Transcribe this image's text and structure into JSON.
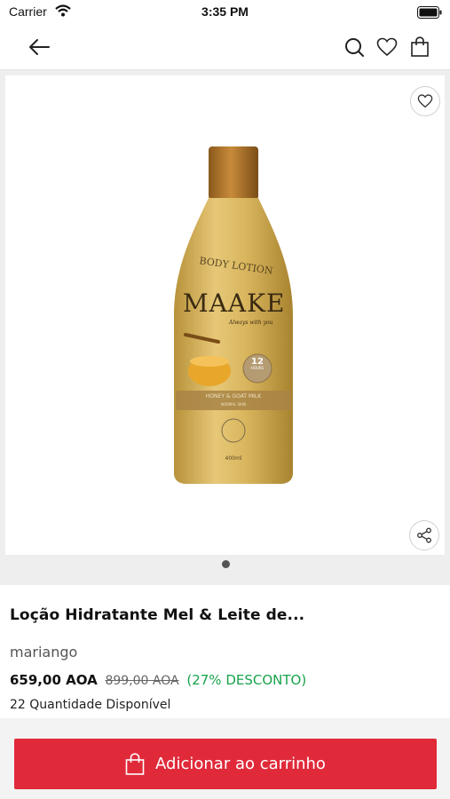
{
  "status_bar": {
    "carrier": "Carrier",
    "time": "3:35 PM"
  },
  "navbar": {
    "back_icon": "arrow-left-icon",
    "search_icon": "search-icon",
    "wishlist_icon": "heart-icon",
    "bag_icon": "shopping-bag-icon"
  },
  "gallery": {
    "image_label_top": "BODY LOTION",
    "brand": "MAAKE",
    "tagline": "Always with you",
    "variant": "HONEY & GOAT MILK",
    "variant_sub": "NORMAL SKIN",
    "hours": "12",
    "hours_label": "HOURS",
    "volume": "400ml",
    "page_indicator": {
      "current": 1,
      "total": 1
    }
  },
  "product": {
    "title": "Loção Hidratante Mel & Leite de...",
    "seller": "mariango",
    "price": "659,00 AOA",
    "old_price": "899,00 AOA",
    "discount": "(27% DESCONTO)",
    "stock": "22 Quantidade Disponível"
  },
  "cart": {
    "label": "Adicionar ao carrinho"
  },
  "colors": {
    "accent": "#e02a3a",
    "discount": "#17a34a"
  }
}
